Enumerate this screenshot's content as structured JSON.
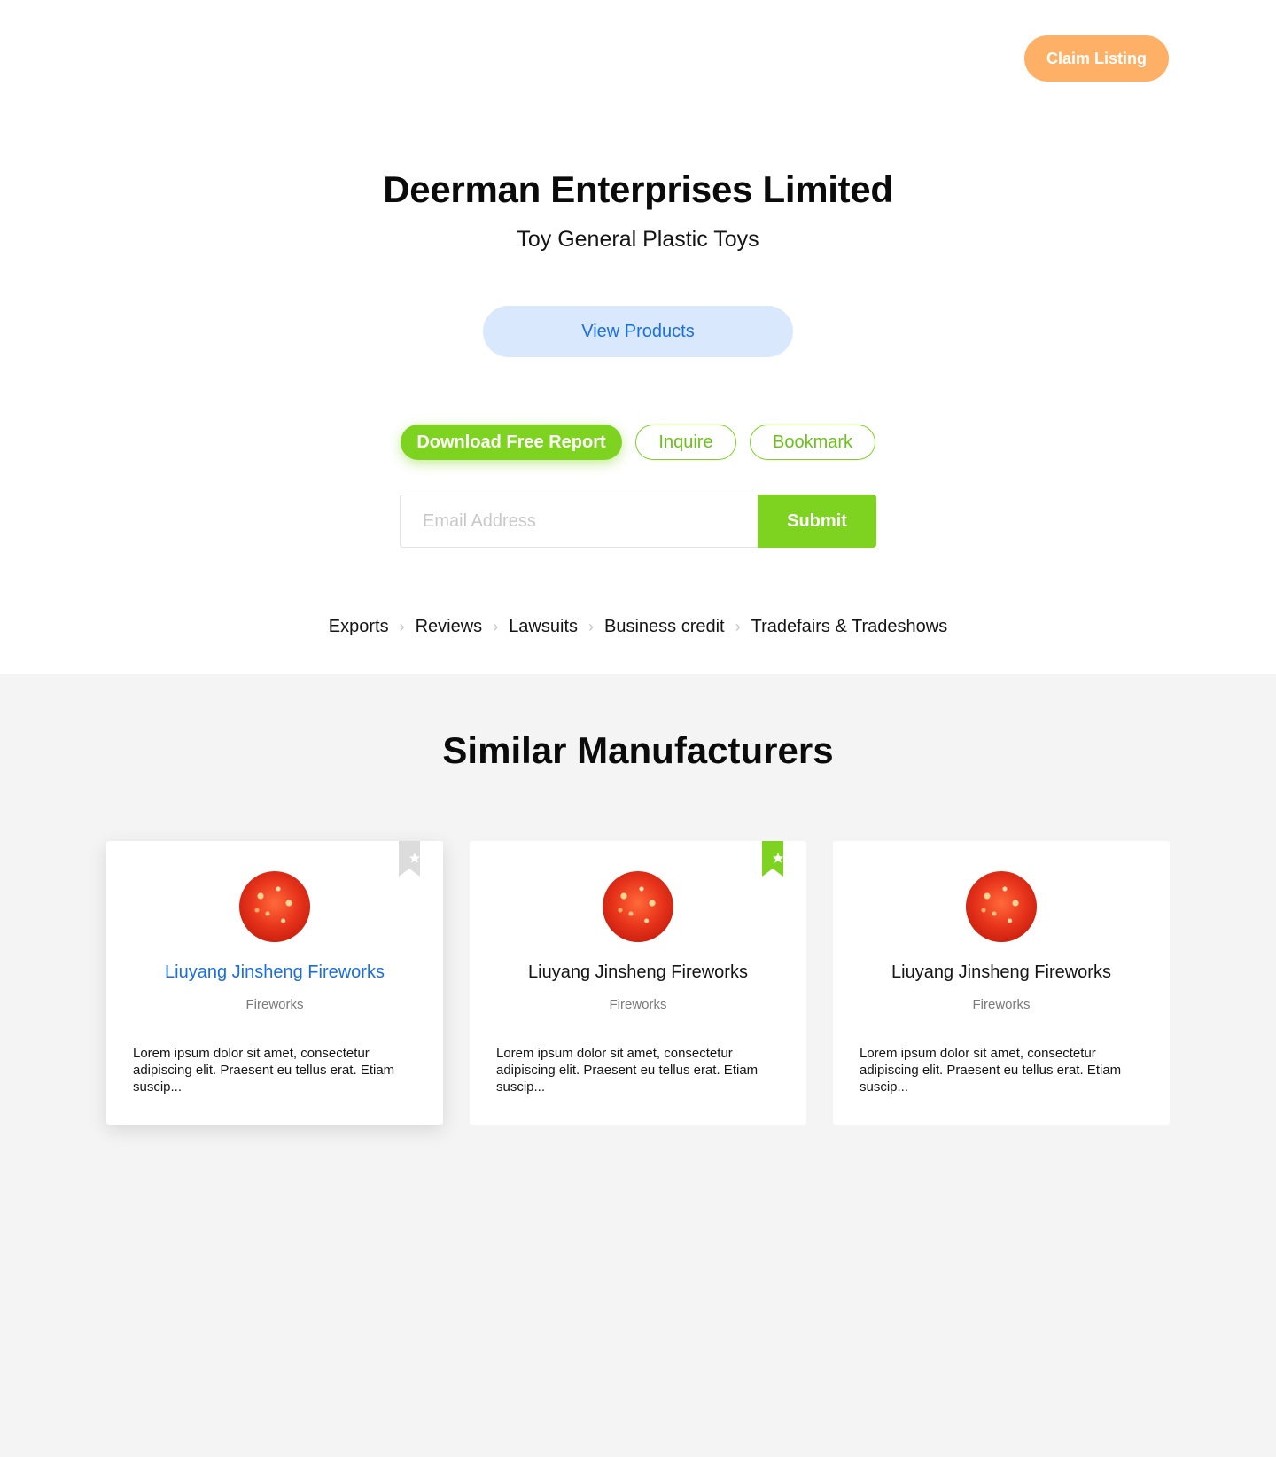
{
  "header": {
    "claim_label": "Claim Listing"
  },
  "company": {
    "name": "Deerman Enterprises Limited",
    "category": "Toy General Plastic Toys",
    "view_products_label": "View Products"
  },
  "actions": {
    "download_label": "Download Free Report",
    "inquire_label": "Inquire",
    "bookmark_label": "Bookmark"
  },
  "email_form": {
    "placeholder": "Email Address",
    "value": "",
    "submit_label": "Submit"
  },
  "tabs": [
    {
      "label": "Exports"
    },
    {
      "label": "Reviews"
    },
    {
      "label": "Lawsuits"
    },
    {
      "label": "Business credit"
    },
    {
      "label": "Tradefairs & Tradeshows"
    }
  ],
  "similar": {
    "title": "Similar Manufacturers",
    "cards": [
      {
        "name": "Liuyang Jinsheng Fireworks",
        "category": "Fireworks",
        "description": "Lorem ipsum dolor sit amet, consectetur adipiscing elit. Praesent eu tellus erat. Etiam suscip...",
        "bookmarked": false
      },
      {
        "name": "Liuyang Jinsheng Fireworks",
        "category": "Fireworks",
        "description": "Lorem ipsum dolor sit amet, consectetur adipiscing elit. Praesent eu tellus erat. Etiam suscip...",
        "bookmarked": true
      },
      {
        "name": "Liuyang Jinsheng Fireworks",
        "category": "Fireworks",
        "description": "Lorem ipsum dolor sit amet, consectetur adipiscing elit. Praesent eu tellus erat. Etiam suscip...",
        "bookmarked": false
      }
    ]
  },
  "colors": {
    "accent_green": "#7ed321",
    "claim_orange": "#ffb067",
    "link_blue": "#1a6fe0",
    "view_products_bg": "#d9e8fd",
    "bookmark_inactive": "#dcdcdc",
    "section_bg": "#f4f4f4"
  }
}
